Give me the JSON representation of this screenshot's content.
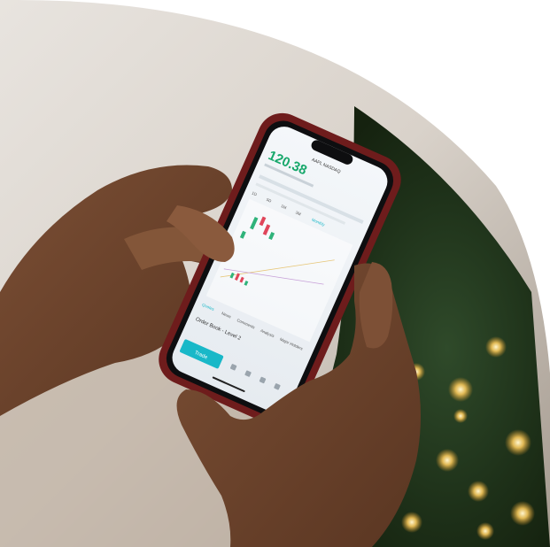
{
  "phone": {
    "ticker": "AAPL NASDAQ",
    "price": "120.38",
    "tabs": [
      "1D",
      "5D",
      "1M",
      "3M",
      "Monthly"
    ],
    "sections": [
      "Quotes",
      "News",
      "Comments",
      "Analysis",
      "Major Holders"
    ],
    "order_book": "Order Book - Level 2",
    "trade_button": "Trade"
  },
  "colors": {
    "accent": "#19b8c8",
    "price_green": "#17a86b",
    "candle_red": "#e0455a",
    "candle_green": "#2fb37a",
    "phone_case": "#6e1c1c"
  }
}
